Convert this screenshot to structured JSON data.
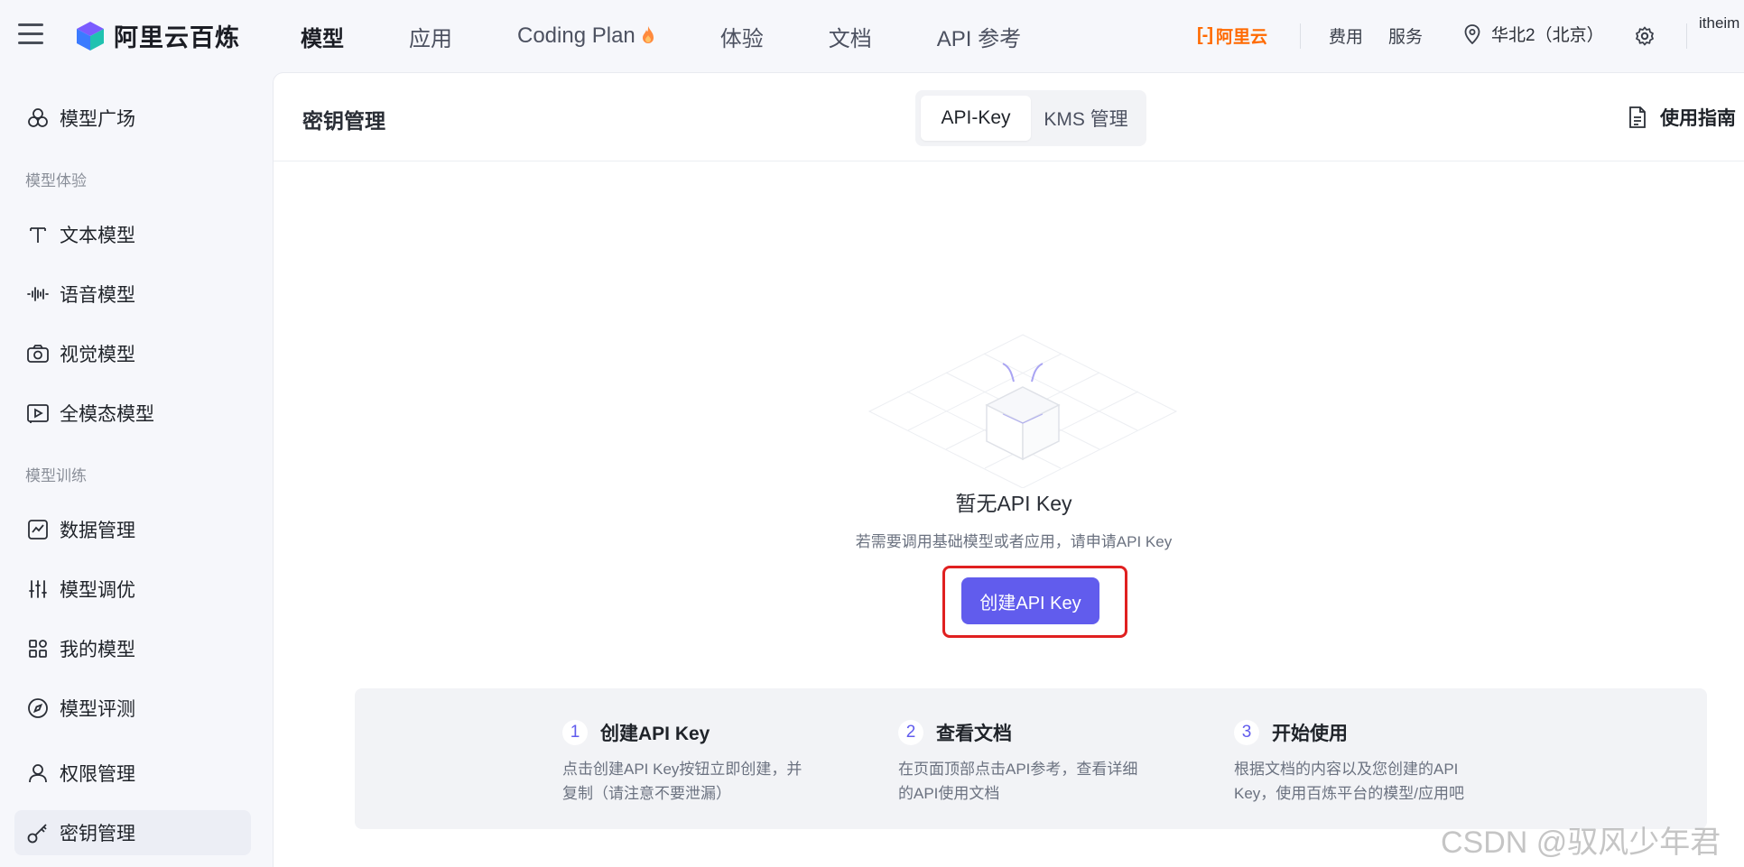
{
  "brand": {
    "name": "阿里云百炼",
    "accent": "#615ced"
  },
  "topnav": {
    "items": [
      {
        "label": "模型",
        "active": true
      },
      {
        "label": "应用",
        "active": false
      },
      {
        "label": "Coding Plan",
        "active": false,
        "icon": "flame-icon"
      },
      {
        "label": "体验",
        "active": false
      },
      {
        "label": "文档",
        "active": false
      },
      {
        "label": "API 参考",
        "active": false
      }
    ],
    "aliyun_label": "阿里云",
    "fee_label": "费用",
    "service_label": "服务",
    "region_label": "华北2（北京）",
    "user_label": "itheim"
  },
  "sidebar": {
    "items": [
      {
        "label": "模型广场",
        "icon": "model-square-icon"
      },
      {
        "label": "文本模型",
        "icon": "text-icon"
      },
      {
        "label": "语音模型",
        "icon": "audio-wave-icon"
      },
      {
        "label": "视觉模型",
        "icon": "camera-icon"
      },
      {
        "label": "全模态模型",
        "icon": "video-play-icon"
      },
      {
        "label": "数据管理",
        "icon": "chart-icon"
      },
      {
        "label": "模型调优",
        "icon": "sliders-icon"
      },
      {
        "label": "我的模型",
        "icon": "grid-icon"
      },
      {
        "label": "模型评测",
        "icon": "compass-icon"
      },
      {
        "label": "权限管理",
        "icon": "user-icon"
      },
      {
        "label": "密钥管理",
        "icon": "key-icon",
        "active": true
      }
    ],
    "groups": [
      "模型体验",
      "模型训练"
    ]
  },
  "main": {
    "title": "密钥管理",
    "tabs": [
      {
        "label": "API-Key",
        "active": true
      },
      {
        "label": "KMS 管理",
        "active": false
      }
    ],
    "guide_label": "使用指南",
    "empty": {
      "title": "暂无API Key",
      "desc": "若需要调用基础模型或者应用，请申请API Key",
      "button": "创建API Key"
    },
    "steps": [
      {
        "num": "1",
        "title": "创建API Key",
        "desc_line1": "点击创建API Key按钮立即创建，并",
        "desc_line2": "复制（请注意不要泄漏）"
      },
      {
        "num": "2",
        "title": "查看文档",
        "desc_line1": "在页面顶部点击API参考，查看详细",
        "desc_line2": "的API使用文档"
      },
      {
        "num": "3",
        "title": "开始使用",
        "desc_line1": "根据文档的内容以及您创建的API",
        "desc_line2": "Key，使用百炼平台的模型/应用吧"
      }
    ]
  },
  "watermark": "CSDN @驭风少年君"
}
